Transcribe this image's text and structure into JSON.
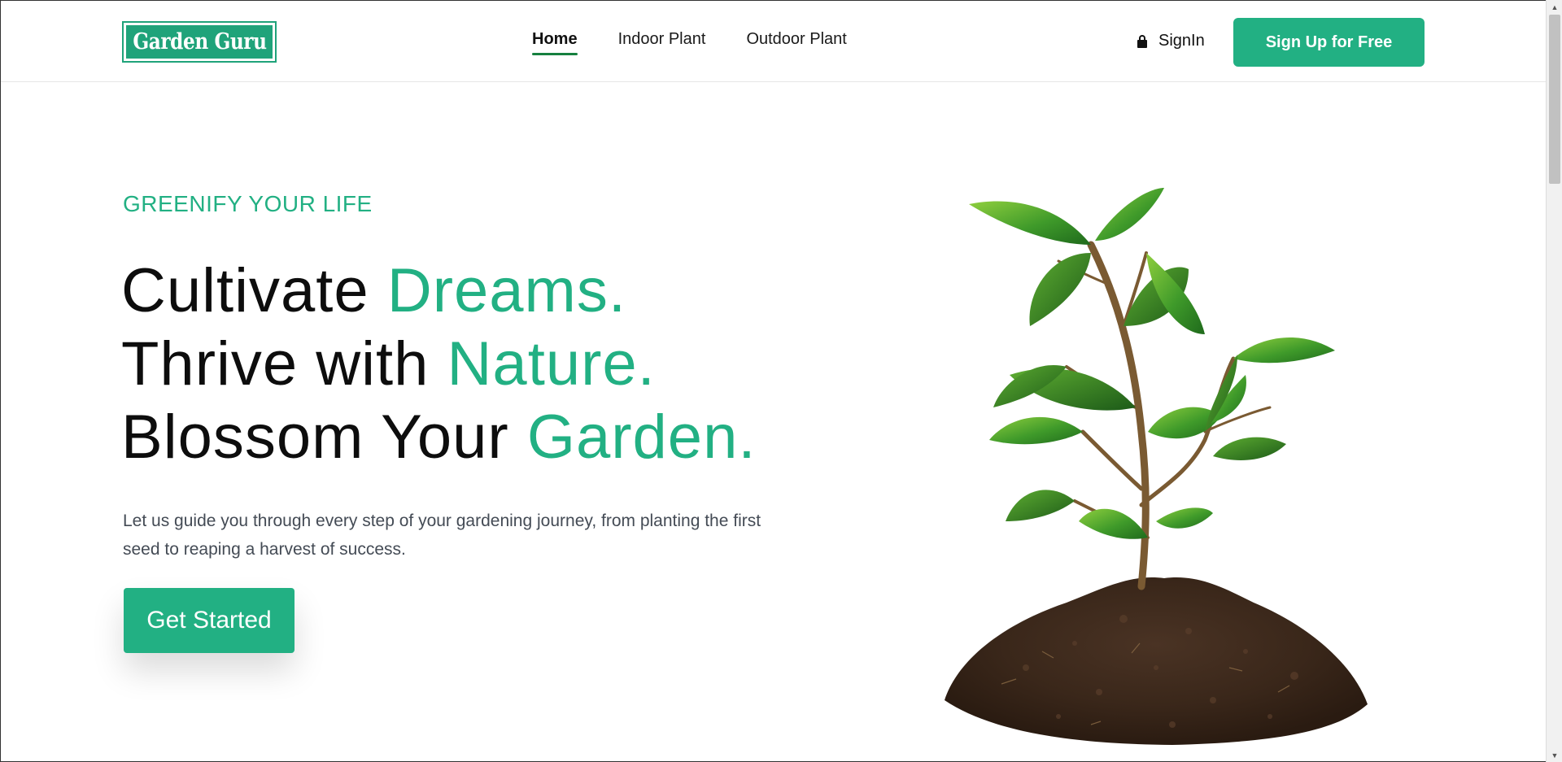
{
  "header": {
    "logo_text": "Garden Guru",
    "nav": [
      {
        "label": "Home",
        "active": true
      },
      {
        "label": "Indoor Plant",
        "active": false
      },
      {
        "label": "Outdoor Plant",
        "active": false
      }
    ],
    "signin_label": "SignIn",
    "signup_label": "Sign Up for Free"
  },
  "hero": {
    "eyebrow": "GREENIFY YOUR LIFE",
    "lines": [
      {
        "plain": "Cultivate ",
        "accent": "Dreams."
      },
      {
        "plain": "Thrive with ",
        "accent": "Nature."
      },
      {
        "plain": "Blossom Your ",
        "accent": "Garden."
      }
    ],
    "description": "Let us guide you through every step of your gardening journey, from planting the first seed to reaping a harvest of success.",
    "cta_label": "Get Started"
  },
  "colors": {
    "accent": "#22b083",
    "nav_underline": "#16803f",
    "text_dark": "#0d0d0d",
    "text_muted": "#444b55"
  },
  "icons": {
    "signin": "lock-icon",
    "scroll_up": "triangle-up-icon",
    "scroll_down": "triangle-down-icon"
  }
}
